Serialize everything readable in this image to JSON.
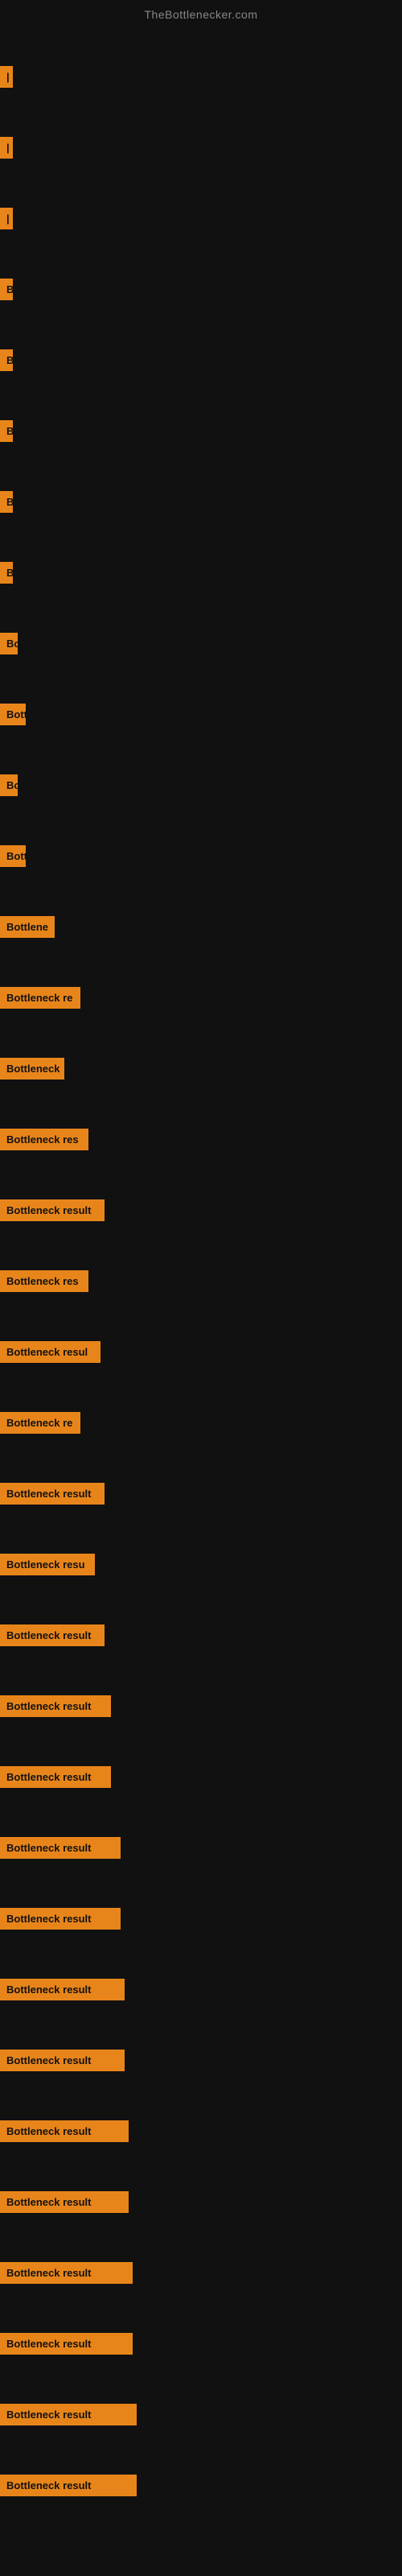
{
  "site": {
    "title": "TheBottlenecker.com"
  },
  "bars": [
    {
      "label": "|",
      "width": 8
    },
    {
      "label": "|",
      "width": 8
    },
    {
      "label": "|",
      "width": 8
    },
    {
      "label": "B",
      "width": 12
    },
    {
      "label": "B",
      "width": 12
    },
    {
      "label": "B",
      "width": 12
    },
    {
      "label": "B",
      "width": 14
    },
    {
      "label": "B",
      "width": 14
    },
    {
      "label": "Bo",
      "width": 22
    },
    {
      "label": "Bott",
      "width": 32
    },
    {
      "label": "Bo",
      "width": 22
    },
    {
      "label": "Bott",
      "width": 32
    },
    {
      "label": "Bottlene",
      "width": 68
    },
    {
      "label": "Bottleneck re",
      "width": 100
    },
    {
      "label": "Bottleneck",
      "width": 80
    },
    {
      "label": "Bottleneck res",
      "width": 110
    },
    {
      "label": "Bottleneck result",
      "width": 130
    },
    {
      "label": "Bottleneck res",
      "width": 110
    },
    {
      "label": "Bottleneck resul",
      "width": 125
    },
    {
      "label": "Bottleneck re",
      "width": 100
    },
    {
      "label": "Bottleneck result",
      "width": 130
    },
    {
      "label": "Bottleneck resu",
      "width": 118
    },
    {
      "label": "Bottleneck result",
      "width": 130
    },
    {
      "label": "Bottleneck result",
      "width": 138
    },
    {
      "label": "Bottleneck result",
      "width": 138
    },
    {
      "label": "Bottleneck result",
      "width": 150
    },
    {
      "label": "Bottleneck result",
      "width": 150
    },
    {
      "label": "Bottleneck result",
      "width": 155
    },
    {
      "label": "Bottleneck result",
      "width": 155
    },
    {
      "label": "Bottleneck result",
      "width": 160
    },
    {
      "label": "Bottleneck result",
      "width": 160
    },
    {
      "label": "Bottleneck result",
      "width": 165
    },
    {
      "label": "Bottleneck result",
      "width": 165
    },
    {
      "label": "Bottleneck result",
      "width": 170
    },
    {
      "label": "Bottleneck result",
      "width": 170
    }
  ]
}
